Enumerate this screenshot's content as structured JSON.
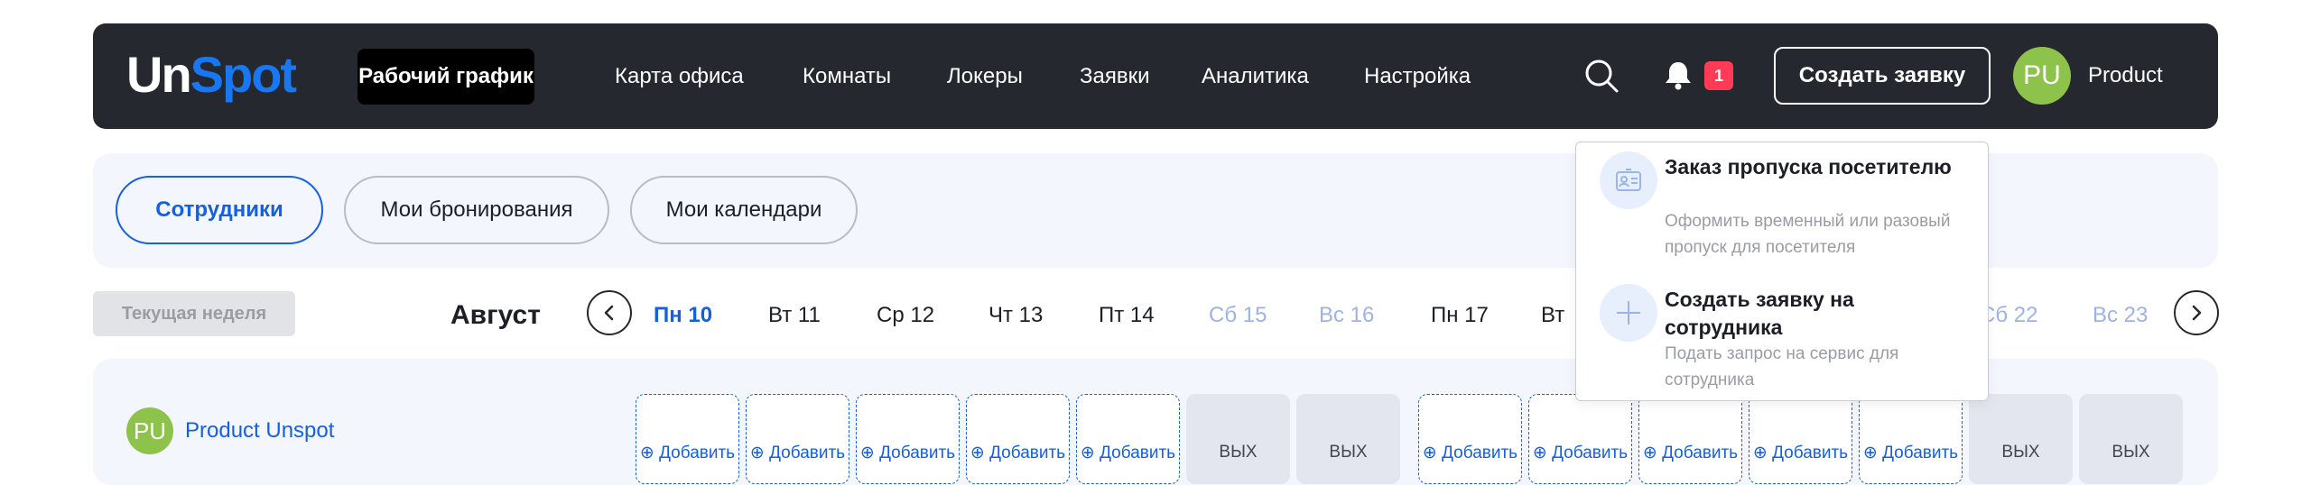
{
  "brand": {
    "logo_part1": "Un",
    "logo_part2": "Spot"
  },
  "nav": {
    "items": [
      {
        "label": "Рабочий график",
        "active": true
      },
      {
        "label": "Карта офиса"
      },
      {
        "label": "Комнаты"
      },
      {
        "label": "Локеры"
      },
      {
        "label": "Заявки"
      },
      {
        "label": "Аналитика"
      },
      {
        "label": "Настройка"
      }
    ],
    "notification_count": "1",
    "create_request_label": "Создать заявку",
    "user_initials": "PU",
    "user_label": "Product"
  },
  "tabs": [
    {
      "label": "Сотрудники",
      "active": true
    },
    {
      "label": "Мои бронирования"
    },
    {
      "label": "Мои календари"
    }
  ],
  "week": {
    "current_week_label": "Текущая неделя",
    "month": "Август",
    "days": [
      {
        "label": "Пн 10",
        "state": "today"
      },
      {
        "label": "Вт 11",
        "state": "normal"
      },
      {
        "label": "Ср 12",
        "state": "normal"
      },
      {
        "label": "Чт 13",
        "state": "normal"
      },
      {
        "label": "Пт 14",
        "state": "normal"
      },
      {
        "label": "Сб 15",
        "state": "weekend"
      },
      {
        "label": "Вс 16",
        "state": "weekend"
      },
      {
        "label": "Пн 17",
        "state": "normal"
      },
      {
        "label": "Вт",
        "state": "normal"
      },
      {
        "label": "Сб 22",
        "state": "weekend"
      },
      {
        "label": "Вс 23",
        "state": "weekend"
      }
    ]
  },
  "schedule": {
    "employee_initials": "PU",
    "employee_name": "Product Unspot",
    "add_label": "⊕ Добавить",
    "off_label": "ВЫХ",
    "cells": [
      "add",
      "add",
      "add",
      "add",
      "add",
      "off",
      "off",
      "add",
      "add",
      "add",
      "add",
      "add",
      "off",
      "off"
    ]
  },
  "dropdown": {
    "items": [
      {
        "title": "Заказ пропуска посетителю",
        "description": "Оформить временный или разовый пропуск для посетителя",
        "icon": "id-card-icon"
      },
      {
        "title": "Создать заявку на сотрудника",
        "description": "Подать запрос на сервис для сотрудника",
        "icon": "plus-icon"
      }
    ]
  },
  "colors": {
    "navbar_bg": "#26282f",
    "brand_blue": "#1877f2",
    "accent_blue": "#1560e0",
    "badge_red": "#ff3b55",
    "avatar_green": "#8dc34a",
    "panel_bg": "#f3f6fd",
    "weekend_text": "#9bb3e8"
  }
}
